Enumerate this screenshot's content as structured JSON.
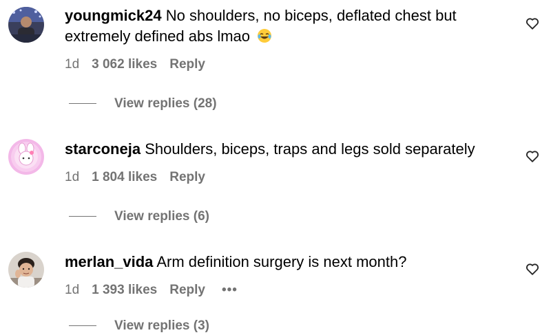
{
  "comments": [
    {
      "username": "youngmick24",
      "text": "No shoulders, no biceps, deflated chest but extremely defined abs lmao",
      "emoji": "😂",
      "age": "1d",
      "likes": "3 062 likes",
      "reply_label": "Reply",
      "view_replies": "View replies (28)"
    },
    {
      "username": "starconeja",
      "text": "Shoulders, biceps, traps and legs sold separately",
      "age": "1d",
      "likes": "1 804 likes",
      "reply_label": "Reply",
      "view_replies": "View replies (6)"
    },
    {
      "username": "merlan_vida",
      "text": "Arm definition surgery is next month?",
      "age": "1d",
      "likes": "1 393 likes",
      "reply_label": "Reply",
      "more_label": "•••",
      "view_replies": "View replies (3)"
    }
  ],
  "colors": {
    "text": "#000000",
    "secondary": "#737373",
    "background": "#ffffff"
  },
  "icons": {
    "like": "heart-outline-icon",
    "more": "more-options-icon",
    "emoji": "face-with-tears-of-joy-emoji"
  }
}
